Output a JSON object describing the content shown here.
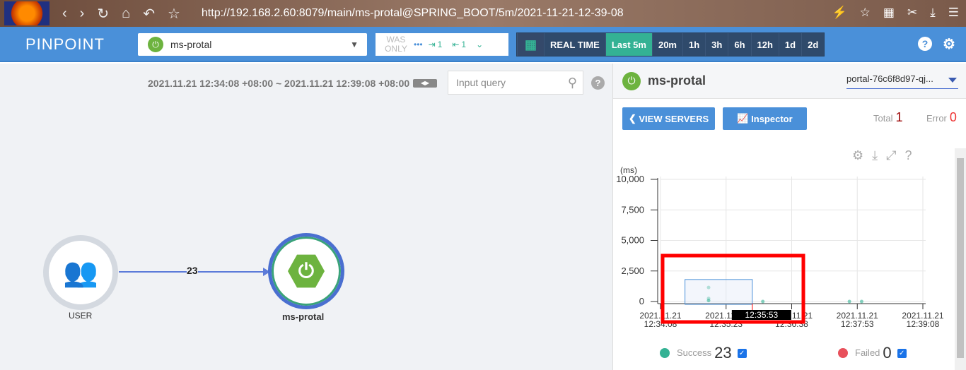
{
  "browser": {
    "url": "http://192.168.2.60:8079/main/ms-protal@SPRING_BOOT/5m/2021-11-21-12-39-08"
  },
  "header": {
    "logo": "PINPOINT",
    "app": "ms-protal",
    "was_only": "WAS ONLY",
    "inbound": "1",
    "outbound": "1",
    "time_buttons": [
      "REAL TIME",
      "Last 5m",
      "20m",
      "1h",
      "3h",
      "6h",
      "12h",
      "1d",
      "2d"
    ],
    "active_time": "Last 5m"
  },
  "servermap": {
    "range": "2021.11.21 12:34:08 +08:00 ~ 2021.11.21 12:39:08 +08:00",
    "query_placeholder": "Input query",
    "nodes": {
      "user": "USER",
      "app": "ms-protal"
    },
    "edge_count": "23"
  },
  "panel": {
    "title": "ms-protal",
    "agent": "portal-76c6f8d97-qj...",
    "view_servers": "VIEW SERVERS",
    "inspector": "Inspector",
    "total_label": "Total",
    "total": "1",
    "error_label": "Error",
    "error": "0",
    "success_label": "Success",
    "success": "23",
    "failed_label": "Failed",
    "failed": "0",
    "colors": {
      "success": "#34b294",
      "failed": "#e8505b",
      "selection_highlight": "#ff0000"
    }
  },
  "chart_data": {
    "type": "scatter",
    "ylabel": "(ms)",
    "ylim": [
      0,
      10000
    ],
    "yticks": [
      "10,000",
      "7,500",
      "5,000",
      "2,500",
      "0"
    ],
    "xticks": [
      [
        "2021.11.21",
        "12:34:08"
      ],
      [
        "2021.11.21",
        "12:35:23"
      ],
      [
        "2021.11.21",
        "12:36:38"
      ],
      [
        "2021.11.21",
        "12:37:53"
      ],
      [
        "2021.11.21",
        "12:39:08"
      ]
    ],
    "xlim": [
      "12:34:08",
      "12:39:08"
    ],
    "points": [
      {
        "t": "12:35:03",
        "y": 1150
      },
      {
        "t": "12:35:03",
        "y": 250
      },
      {
        "t": "12:35:03",
        "y": 80
      },
      {
        "t": "12:36:05",
        "y": 0
      },
      {
        "t": "12:37:44",
        "y": 0
      },
      {
        "t": "12:37:58",
        "y": 0
      }
    ],
    "selection": {
      "from": "12:34:36",
      "to": "12:35:53",
      "ymin": 0,
      "ymax": 1800
    },
    "cursor_label": "12:35:53",
    "grid": true
  }
}
